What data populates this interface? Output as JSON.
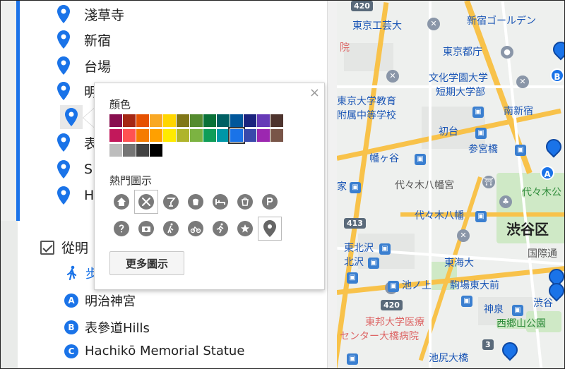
{
  "places": [
    {
      "name": "淺草寺"
    },
    {
      "name": "新宿"
    },
    {
      "name": "台場"
    },
    {
      "name": "明"
    },
    {
      "name": ""
    },
    {
      "name": "表"
    },
    {
      "name": "S"
    },
    {
      "name": "H"
    }
  ],
  "layer": {
    "title": "從明",
    "travel_mode_label": "步",
    "routes": [
      {
        "letter": "A",
        "name": "明治神宮"
      },
      {
        "letter": "B",
        "name": "表參道Hills"
      },
      {
        "letter": "C",
        "name": "Hachikō Memorial Statue"
      }
    ]
  },
  "popup": {
    "color_title": "顏色",
    "icons_title": "熱門圖示",
    "more_button": "更多圖示",
    "close": "×",
    "selected_color": "#1a73e8",
    "color_rows": [
      [
        "#880e4f",
        "#a52714",
        "#e65100",
        "#f9a825",
        "#ffd600",
        "#817717",
        "#558b2f",
        "#097138",
        "#006064",
        "#01579b",
        "#1a237e",
        "#673ab7",
        "#4e342e"
      ],
      [
        "#c2185b",
        "#ff5252",
        "#f57c00",
        "#ffa000",
        "#ffea00",
        "#afb42b",
        "#7cb342",
        "#0f9d58",
        "#0097a7",
        "#1a73e8",
        "#3949ab",
        "#9c27b0",
        "#795548"
      ],
      [
        "#bdbdbd",
        "#757575",
        "#424242",
        "#000000"
      ]
    ],
    "icon_rows": [
      [
        "home-icon",
        "dining-icon",
        "bar-icon",
        "coffee-icon",
        "hotel-icon",
        "shopping-icon",
        "parking-icon"
      ],
      [
        "help-icon",
        "camera-icon",
        "hiking-icon",
        "cycling-icon",
        "running-icon",
        "star-icon",
        "pin-icon"
      ]
    ],
    "selected_icon": "dining-icon"
  },
  "map": {
    "labels": [
      {
        "text": "420",
        "cls": "gray"
      },
      {
        "text": "東京工芸大",
        "cls": "blue"
      },
      {
        "text": "新宿ゴールデン",
        "cls": "blue"
      },
      {
        "text": "院",
        "cls": "red"
      },
      {
        "text": "東京都庁",
        "cls": "blue"
      },
      {
        "text": "文化学園大学",
        "cls": "blue"
      },
      {
        "text": "短期大学部",
        "cls": "blue"
      },
      {
        "text": "東京大学教育",
        "cls": "blue"
      },
      {
        "text": "附属中等学校",
        "cls": "blue"
      },
      {
        "text": "南新宿",
        "cls": "blue"
      },
      {
        "text": "初台",
        "cls": "blue"
      },
      {
        "text": "参宮橋",
        "cls": "blue"
      },
      {
        "text": "幡ヶ谷",
        "cls": "blue"
      },
      {
        "text": "家",
        "cls": "blue"
      },
      {
        "text": "代々木八幡宮",
        "cls": "gray"
      },
      {
        "text": "代々木公",
        "cls": "green"
      },
      {
        "text": "代々木八幡",
        "cls": "blue"
      },
      {
        "text": "413",
        "cls": "gray"
      },
      {
        "text": "渋谷区",
        "cls": "big"
      },
      {
        "text": "東北沢",
        "cls": "blue"
      },
      {
        "text": "北沢",
        "cls": "blue"
      },
      {
        "text": "国際通",
        "cls": "gray"
      },
      {
        "text": "東海大",
        "cls": "blue"
      },
      {
        "text": "池ノ上",
        "cls": "blue"
      },
      {
        "text": "駒場東大前",
        "cls": "blue"
      },
      {
        "text": "420",
        "cls": "gray"
      },
      {
        "text": "神泉",
        "cls": "blue"
      },
      {
        "text": "渋谷",
        "cls": "blue"
      },
      {
        "text": "東邦大学医療",
        "cls": "red"
      },
      {
        "text": "センター大橋病院",
        "cls": "red"
      },
      {
        "text": "西郷山公園",
        "cls": "green"
      },
      {
        "text": "池尻大橋",
        "cls": "blue"
      },
      {
        "text": "3",
        "cls": "gray"
      },
      {
        "text": "A",
        "cls": "gray"
      },
      {
        "text": "B",
        "cls": "gray"
      }
    ]
  }
}
